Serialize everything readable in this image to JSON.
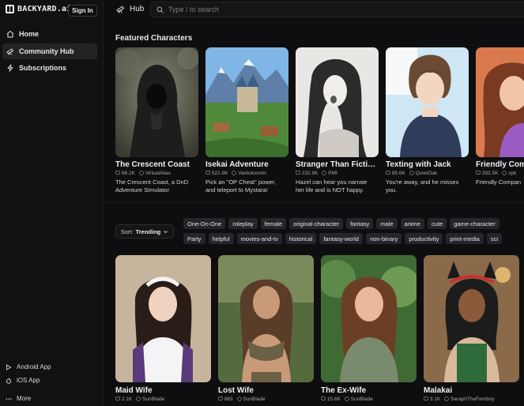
{
  "app": {
    "logo_text": "BACKYARD.ai",
    "signin_label": "Sign In"
  },
  "nav": {
    "home": "Home",
    "community_hub": "Community Hub",
    "subscriptions": "Subscriptions"
  },
  "side_bottom": {
    "android": "Android App",
    "ios": "iOS App",
    "more": "More"
  },
  "topbar": {
    "hub_label": "Hub",
    "search_placeholder": "Type / to search"
  },
  "featured": {
    "title": "Featured Characters",
    "cards": [
      {
        "name": "The Crescent Coast",
        "count": "68.2K",
        "author": "VirtualAlias",
        "desc1": "The Crescent Coast, a DnD",
        "desc2": "Adventure Simulator"
      },
      {
        "name": "Isekai Adventure",
        "count": "522.8K",
        "author": "Vantoloomin",
        "desc1": "Pick an \"OP Cheat\" power,",
        "desc2": "and teleport to Mystara!"
      },
      {
        "name": "Stranger Than Ficti…",
        "count": "232.9K",
        "author": "PMI",
        "desc1": "Hazel can hear you narrate",
        "desc2": "her life and is NOT happy."
      },
      {
        "name": "Texting with Jack",
        "count": "85.6K",
        "author": "QuietOak",
        "desc1": "You're away, and he misses",
        "desc2": "you."
      },
      {
        "name": "Friendly Com",
        "count": "292.5K",
        "author": "spk",
        "desc1": "Friendly Compan",
        "desc2": ""
      }
    ]
  },
  "filters": {
    "sort_prefix": "Sort:",
    "sort_value": "Trending",
    "tags_row1": [
      "One-On-One",
      "roleplay",
      "female",
      "original-character",
      "fantasy",
      "male",
      "anime",
      "cute",
      "game-character"
    ],
    "tags_row2": [
      "Party",
      "helpful",
      "movies-and-tv",
      "historical",
      "fantasy-world",
      "non-binary",
      "productivity",
      "print-media",
      "sci"
    ]
  },
  "grid": {
    "cards": [
      {
        "name": "Maid Wife",
        "count": "2.1K",
        "author": "SunBlade"
      },
      {
        "name": "Lost Wife",
        "count": "883",
        "author": "SunBlade"
      },
      {
        "name": "The Ex-Wife",
        "count": "15.6K",
        "author": "SunBlade"
      },
      {
        "name": "Malakai",
        "count": "3.1K",
        "author": "SeraphTheFemboy"
      }
    ]
  },
  "colors": {
    "background": "#0e0e10",
    "sidebar": "#111113",
    "active_nav": "#232326",
    "tag_bg": "#25252a"
  }
}
